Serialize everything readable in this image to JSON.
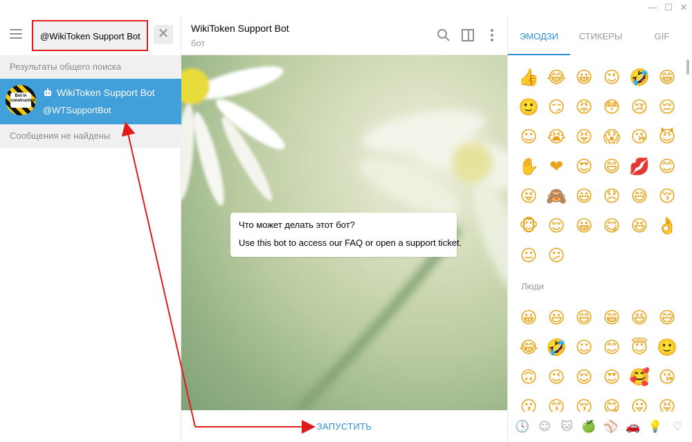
{
  "window": {
    "controls": {
      "minimize": "—",
      "maximize": "☐",
      "close": "✕"
    }
  },
  "sidebar": {
    "search": {
      "value": "@WikiToken Support Bot"
    },
    "clear_label": "✕",
    "global_results_label": "Результаты общего поиска",
    "result": {
      "name": "WikiToken Support Bot",
      "username": "@WTSupportBot",
      "avatar_text": "Bot in construction"
    },
    "no_messages_label": "Сообщения не найдены"
  },
  "chat": {
    "title": "WikiToken Support Bot",
    "status": "бот",
    "info_card": {
      "title": "Что может делать этот бот?",
      "text": "Use this bot to access our FAQ or open a support ticket."
    },
    "start_label": "ЗАПУСТИТЬ"
  },
  "emoji_panel": {
    "tabs": [
      {
        "label": "ЭМОДЗИ",
        "active": true
      },
      {
        "label": "СТИКЕРЫ",
        "active": false
      },
      {
        "label": "GIF",
        "active": false
      }
    ],
    "recent": [
      "👍",
      "😂",
      "😀",
      "😉",
      "🤣",
      "😁",
      "🙂",
      "😏",
      "😡",
      "😳",
      "😢",
      "😔",
      "☺",
      "😭",
      "😝",
      "😱",
      "😘",
      "😈",
      "✋",
      "❤",
      "😍",
      "😄",
      "💋",
      "😊",
      "😜",
      "🙈",
      "😃",
      "😞",
      "😅",
      "😚",
      "🐵",
      "😌",
      "😀",
      "😋",
      "😆",
      "👌",
      "😐",
      "😕"
    ],
    "people_label": "Люди",
    "people": [
      "😀",
      "😃",
      "😄",
      "😁",
      "😆",
      "😅",
      "😂",
      "🤣",
      "☺",
      "😊",
      "😇",
      "🙂",
      "🙃",
      "😉",
      "😌",
      "😍",
      "🥰",
      "😘",
      "😗",
      "😙",
      "😚",
      "😋",
      "😛",
      "😝"
    ],
    "categories": [
      {
        "icon": "clock-icon",
        "glyph": "🕓"
      },
      {
        "icon": "smile-icon",
        "glyph": "☺"
      },
      {
        "icon": "cat-icon",
        "glyph": "🐱"
      },
      {
        "icon": "apple-icon",
        "glyph": "🍏"
      },
      {
        "icon": "ball-icon",
        "glyph": "⚾"
      },
      {
        "icon": "car-icon",
        "glyph": "🚗"
      },
      {
        "icon": "bulb-icon",
        "glyph": "💡"
      },
      {
        "icon": "heart-icon",
        "glyph": "♡"
      }
    ],
    "accent_color": "#2d8fd5"
  },
  "colors": {
    "selection": "#419fd9",
    "accent": "#2d8fd5",
    "annotation": "#e01b1b"
  }
}
